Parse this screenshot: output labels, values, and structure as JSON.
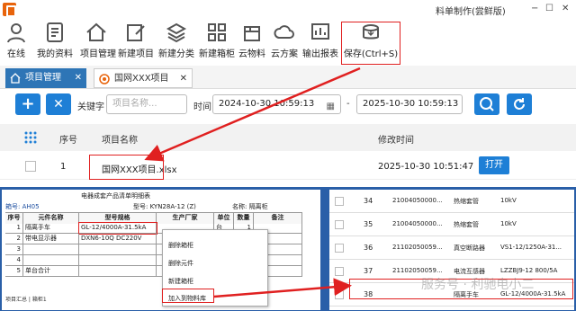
{
  "window": {
    "title": "料单制作(尝鲜版)",
    "controls": [
      "−",
      "☐",
      "✕"
    ]
  },
  "toolbar": {
    "items": [
      {
        "label": "在线",
        "icon": "person-icon"
      },
      {
        "label": "我的资料",
        "icon": "my-files-icon"
      },
      {
        "label": "项目管理",
        "icon": "home-icon"
      },
      {
        "label": "新建项目",
        "icon": "new-project-icon"
      },
      {
        "label": "新建分类",
        "icon": "layers-icon"
      },
      {
        "label": "新建箱柜",
        "icon": "grid-icon"
      },
      {
        "label": "云物料",
        "icon": "cloud-box-icon"
      },
      {
        "label": "云方案",
        "icon": "cloud-plan-icon"
      },
      {
        "label": "输出报表",
        "icon": "report-icon"
      },
      {
        "label": "保存(Ctrl+S)",
        "icon": "save-icon"
      }
    ]
  },
  "tabs": [
    {
      "label": "项目管理",
      "close": "✕"
    },
    {
      "label": "国网XXX项目",
      "close": "✕"
    }
  ],
  "search": {
    "add_label": "+",
    "remove_label": "✕",
    "keyword_label": "关键字",
    "keyword_placeholder": "项目名称...",
    "time_label": "时间",
    "start_time": "2024-10-30 10:59:13",
    "separator": "-",
    "end_time": "2025-10-30 10:59:13"
  },
  "table": {
    "headers": {
      "index": "序号",
      "name": "项目名称",
      "modified": "修改时间"
    },
    "rows": [
      {
        "index": "1",
        "name": "国网XXX项目.xlsx",
        "modified": "2025-10-30 10:51:47",
        "action": "打开"
      }
    ]
  },
  "sheet": {
    "title": "电器成套产品清单明细表",
    "meta_left": "箱号: AH05",
    "meta_mid": "型号: KYN28A-12 (Z)",
    "meta_right": "名称: 隔离柜",
    "headers": [
      "序号",
      "元件名称",
      "型号规格",
      "生产厂家",
      "单位",
      "数量",
      "备注"
    ],
    "rows": [
      [
        "1",
        "隔离手车",
        "GL-12/4000A-31.5kA",
        "",
        "台",
        "1",
        ""
      ],
      [
        "2",
        "带电显示器",
        "DXN6-10Q DC220V",
        "",
        "",
        "",
        ""
      ],
      [
        "3",
        "",
        "",
        "",
        "",
        "",
        ""
      ],
      [
        "4",
        "",
        "",
        "",
        "",
        "",
        ""
      ],
      [
        "5",
        "单台合计",
        "",
        "",
        "",
        "",
        ""
      ]
    ],
    "tabs_text": "项目汇总 | 箱柜1"
  },
  "context_menu": {
    "items": [
      "删除箱柜",
      "删除元件",
      "新建箱柜",
      "加入到物料库"
    ]
  },
  "materials": {
    "rows": [
      {
        "no": "34",
        "code": "21004050000...",
        "name": "热缩套管",
        "spec": "10kV"
      },
      {
        "no": "35",
        "code": "21004050000...",
        "name": "热缩套管",
        "spec": "10kV"
      },
      {
        "no": "36",
        "code": "21102050059...",
        "name": "真空断路器",
        "spec": "VS1-12/1250A-31..."
      },
      {
        "no": "37",
        "code": "21102050059...",
        "name": "电流互感器",
        "spec": "LZZBJ9-12 800/5A"
      },
      {
        "no": "38",
        "code": "",
        "name": "隔离手车",
        "spec": "GL-12/4000A-31.5kA"
      }
    ]
  },
  "watermark": "服务号 · 利驰电小二"
}
